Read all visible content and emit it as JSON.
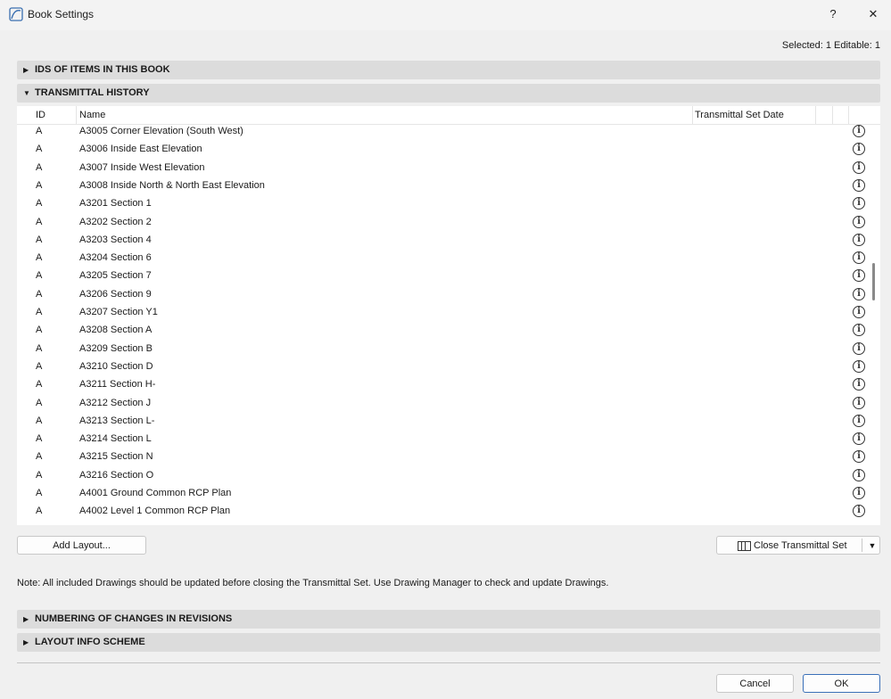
{
  "window": {
    "title": "Book Settings",
    "help_label": "?",
    "close_label": "✕"
  },
  "status": {
    "selected": "Selected: 1 Editable: 1"
  },
  "sections": {
    "ids": "IDS OF ITEMS IN THIS BOOK",
    "transmittal": "TRANSMITTAL HISTORY",
    "numbering": "NUMBERING OF CHANGES IN REVISIONS",
    "layout_info": "LAYOUT INFO SCHEME"
  },
  "table": {
    "columns": {
      "id": "ID",
      "name": "Name",
      "date": "Transmittal Set Date"
    },
    "rows": [
      {
        "id": "A",
        "name": "A3005 Corner Elevation (South West)"
      },
      {
        "id": "A",
        "name": "A3006 Inside East Elevation"
      },
      {
        "id": "A",
        "name": "A3007 Inside West Elevation"
      },
      {
        "id": "A",
        "name": "A3008 Inside North & North East Elevation"
      },
      {
        "id": "A",
        "name": "A3201 Section 1"
      },
      {
        "id": "A",
        "name": "A3202 Section 2"
      },
      {
        "id": "A",
        "name": "A3203 Section 4"
      },
      {
        "id": "A",
        "name": "A3204 Section 6"
      },
      {
        "id": "A",
        "name": "A3205 Section 7"
      },
      {
        "id": "A",
        "name": "A3206 Section 9"
      },
      {
        "id": "A",
        "name": "A3207 Section Y1"
      },
      {
        "id": "A",
        "name": "A3208 Section A"
      },
      {
        "id": "A",
        "name": "A3209 Section B"
      },
      {
        "id": "A",
        "name": "A3210 Section D"
      },
      {
        "id": "A",
        "name": "A3211 Section H-"
      },
      {
        "id": "A",
        "name": "A3212 Section J"
      },
      {
        "id": "A",
        "name": "A3213 Section L-"
      },
      {
        "id": "A",
        "name": "A3214 Section L"
      },
      {
        "id": "A",
        "name": "A3215 Section N"
      },
      {
        "id": "A",
        "name": "A3216 Section O"
      },
      {
        "id": "A",
        "name": "A4001 Ground Common RCP Plan"
      },
      {
        "id": "A",
        "name": "A4002 Level 1 Common RCP Plan"
      }
    ]
  },
  "buttons": {
    "add_layout": "Add Layout...",
    "close_transmittal": "Close Transmittal Set",
    "cancel": "Cancel",
    "ok": "OK"
  },
  "note": "Note: All included Drawings should be updated before closing the Transmittal Set. Use Drawing Manager to check and update Drawings."
}
